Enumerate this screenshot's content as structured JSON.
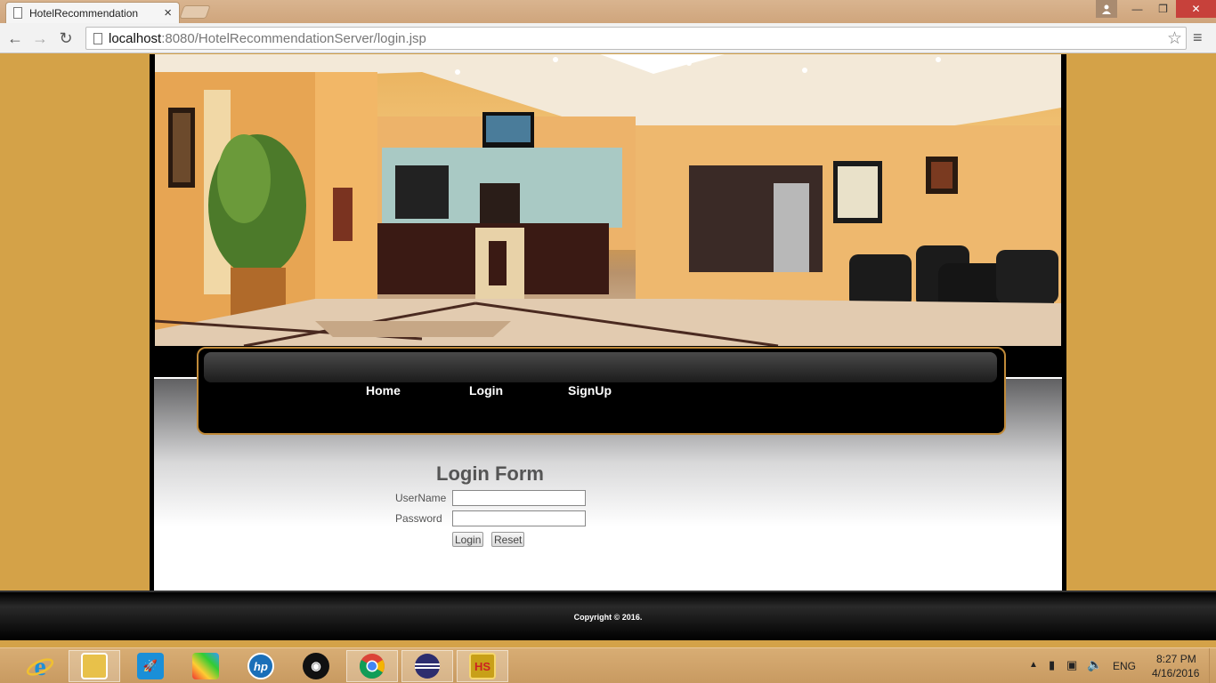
{
  "browser": {
    "tab_title": "HotelRecommendation",
    "url_host": "localhost",
    "url_rest": ":8080/HotelRecommendationServer/login.jsp"
  },
  "site": {
    "nav": [
      "Home",
      "Login",
      "SignUp"
    ],
    "login_form": {
      "title": "Login Form",
      "username_label": "UserName",
      "password_label": "Password",
      "login_button": "Login",
      "reset_button": "Reset"
    },
    "footer": "Copyright © 2016."
  },
  "taskbar": {
    "apps": [
      {
        "name": "internet-explorer",
        "label": "",
        "color": "#1e90d6"
      },
      {
        "name": "file-explorer",
        "label": "",
        "color": "#e8c14a"
      },
      {
        "name": "rocket-app",
        "label": "",
        "color": "#1a8fd8"
      },
      {
        "name": "puzzle-app",
        "label": "",
        "color": "#222222"
      },
      {
        "name": "hp",
        "label": "hp",
        "color": "#1a6fb8"
      },
      {
        "name": "camera-app",
        "label": "",
        "color": "#111111"
      },
      {
        "name": "chrome",
        "label": "",
        "color": "#ffffff"
      },
      {
        "name": "eclipse",
        "label": "",
        "color": "#2c2d6e"
      },
      {
        "name": "hs-app",
        "label": "HS",
        "color": "#c8a018"
      }
    ],
    "language": "ENG",
    "time": "8:27 PM",
    "date": "4/16/2016"
  }
}
